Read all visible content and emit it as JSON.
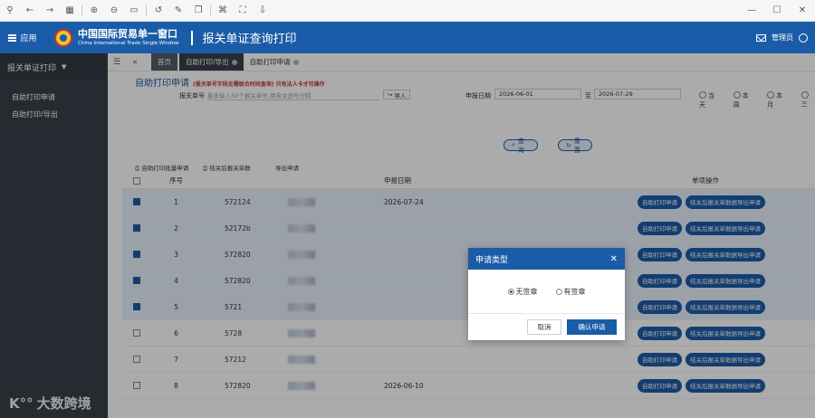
{
  "app": {
    "brand_cn": "中国国际贸易单一窗口",
    "brand_en": "China International Trade Single Window",
    "menu_label": "应用",
    "page_title": "报关单证查询打印",
    "user_label": "管理员"
  },
  "sidebar": {
    "section": "报关单证打印",
    "items": [
      {
        "label": "自助打印申请"
      },
      {
        "label": "自助打印/导出"
      }
    ]
  },
  "tabs": [
    {
      "label": "首页"
    },
    {
      "label": "自助打印/导出"
    },
    {
      "label": "自助打印申请"
    }
  ],
  "form": {
    "title": "自助打印申请",
    "note": "(报关单号字段无需联合时间查询)  只有法人卡才可操作",
    "decl_no_label": "报关单号",
    "decl_no_placeholder": "最多输入50个报关单号,用英文逗号分隔",
    "import_label": "导入",
    "date_label": "申报日期",
    "date_from": "2026-06-01",
    "date_to": "2026-07-29",
    "date_sep": "至",
    "range_options": [
      "当天",
      "本周",
      "本月",
      "三"
    ],
    "search_label": "查询",
    "reset_label": "重置",
    "bulk_apply": "自助打印批量申请",
    "bulk_export": "结关后报关单数",
    "bulk_export_tail": "导出申请"
  },
  "table": {
    "headers": {
      "no": "序号",
      "date": "申报日期",
      "ops": "单项操作"
    },
    "op_apply": "自助打印申请",
    "op_export": "结关后报关单数据导出申请",
    "rows": [
      {
        "no": "1",
        "code": "572124",
        "date": "2026-07-24",
        "checked": true
      },
      {
        "no": "2",
        "code": "52172b",
        "date": "",
        "checked": true
      },
      {
        "no": "3",
        "code": "572820",
        "date": "",
        "checked": true
      },
      {
        "no": "4",
        "code": "572820",
        "date": "",
        "checked": true
      },
      {
        "no": "5",
        "code": "5721",
        "date": "",
        "checked": true
      },
      {
        "no": "6",
        "code": "5728",
        "date": "",
        "checked": false
      },
      {
        "no": "7",
        "code": "57212",
        "date": "",
        "checked": false
      },
      {
        "no": "8",
        "code": "572820",
        "date": "2026-06-10",
        "checked": false
      }
    ]
  },
  "modal": {
    "title": "申请类型",
    "option_no_seal": "无签章",
    "option_seal": "有签章",
    "cancel": "取消",
    "confirm": "确认申请"
  },
  "watermark": "大数跨境"
}
